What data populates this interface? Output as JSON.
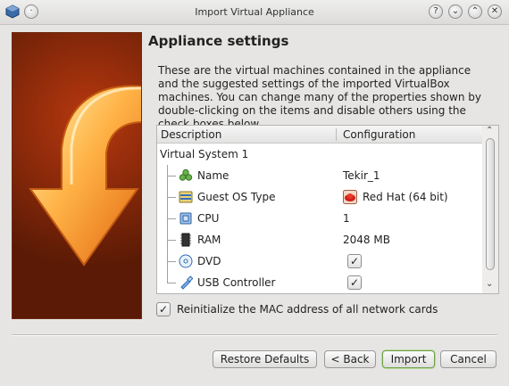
{
  "window": {
    "title": "Import Virtual Appliance"
  },
  "title_buttons": {
    "help": "?",
    "minimize": "⌄",
    "maximize": "⌃",
    "close": "✕"
  },
  "page": {
    "heading": "Appliance settings",
    "description": "These are the virtual machines contained in the appliance and the suggested settings of the imported VirtualBox machines. You can change many of the properties shown by double-clicking on the items and disable others using the check boxes below."
  },
  "table": {
    "headers": [
      "Description",
      "Configuration"
    ],
    "system": "Virtual System 1",
    "rows": [
      {
        "icon": "name-icon",
        "label": "Name",
        "value": "Tekir_1"
      },
      {
        "icon": "guest-os-icon",
        "label": "Guest OS Type",
        "value": "Red Hat (64 bit)"
      },
      {
        "icon": "cpu-icon",
        "label": "CPU",
        "value": "1"
      },
      {
        "icon": "ram-icon",
        "label": "RAM",
        "value": "2048 MB"
      },
      {
        "icon": "dvd-icon",
        "label": "DVD",
        "checked": true
      },
      {
        "icon": "usb-icon",
        "label": "USB Controller",
        "checked": true
      }
    ]
  },
  "options": {
    "reinit_mac_label": "Reinitialize the MAC address of all network cards",
    "reinit_mac_checked": true
  },
  "buttons": {
    "restore": "Restore Defaults",
    "back": "< Back",
    "import": "Import",
    "cancel": "Cancel"
  }
}
